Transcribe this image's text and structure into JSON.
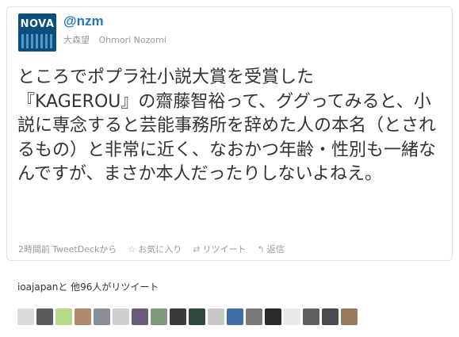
{
  "tweet": {
    "username": "@nzm",
    "display_name": "大森望",
    "romaji_name": "Ohmori Nozomi",
    "avatar_label": "NOVA",
    "body": "ところでポプラ社小説大賞を受賞した\n『KAGEROU』の齋藤智裕って、ググってみると、小説に専念すると芸能事務所を辞めた人の本名（とされるもの）と非常に近く、なおかつ年齢・性別も一緒なんですが、まさか本人だったりしないよねえ。",
    "time": "2時間前",
    "source": "TweetDeck",
    "source_suffix": "から",
    "actions": {
      "favorite": "お気に入り",
      "retweet": "リツイート",
      "reply": "返信"
    },
    "icons": {
      "favorite": "star-icon",
      "retweet": "retweet-icon",
      "reply": "reply-icon"
    }
  },
  "retweets": {
    "first_user": "ioajapan",
    "summary": "と 他96人がリツイート",
    "avatar_colors": [
      "#dcdcdc",
      "#5a5a5a",
      "#b9d98a",
      "#b08a6a",
      "#8a8f97",
      "#cfcfcf",
      "#6a5c7a",
      "#7f9a7a",
      "#3a3a3a",
      "#2f4a3a",
      "#c8c8c8",
      "#3f6ea8",
      "#7a7a7a",
      "#2a2a2a",
      "#e8e8e8",
      "#606060",
      "#4a4a4a",
      "#9a7a5a"
    ]
  }
}
